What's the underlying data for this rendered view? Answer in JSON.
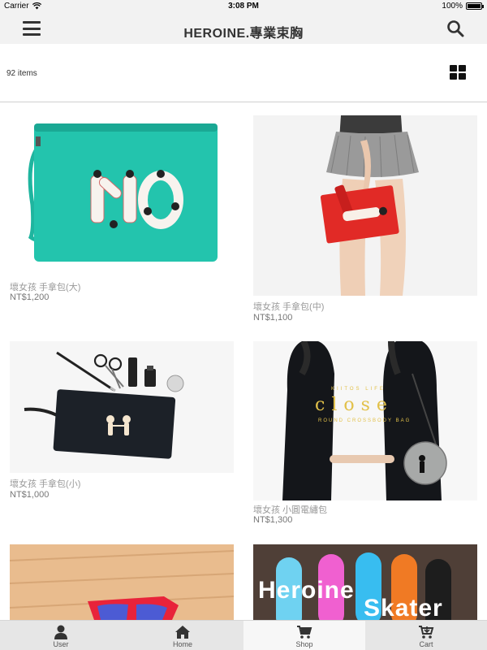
{
  "status_bar": {
    "carrier": "Carrier",
    "time": "3:08 PM",
    "battery": "100%"
  },
  "nav": {
    "title": "HEROINE.專業束胸",
    "menu_icon": "hamburger-menu-icon",
    "search_icon": "search-icon"
  },
  "toolbar": {
    "item_count": "92 items",
    "view_icon": "grid-view-icon"
  },
  "products": [
    {
      "name": "壞女孩 手拿包(大)",
      "price": "NT$1,200"
    },
    {
      "name": "壞女孩 手拿包(中)",
      "price": "NT$1,100"
    },
    {
      "name": "壞女孩 手拿包(小)",
      "price": "NT$1,000"
    },
    {
      "name": "壞女孩 小圓電繡包",
      "price": "NT$1,300"
    },
    {
      "name": "",
      "price": ""
    },
    {
      "name": "",
      "price": ""
    }
  ],
  "promo_text": {
    "bag_brand": "KIITOS LIFE",
    "bag_title": "close",
    "bag_subtitle": "ROUND CROSSBODY BAG",
    "skater_line1": "Heroine",
    "skater_line2": "Skater"
  },
  "tab_bar": {
    "tabs": [
      {
        "label": "User",
        "icon": "user-icon"
      },
      {
        "label": "Home",
        "icon": "home-icon"
      },
      {
        "label": "Shop",
        "icon": "shop-cart-icon"
      },
      {
        "label": "Cart",
        "icon": "cart-icon"
      }
    ],
    "active_tab": "Shop"
  },
  "colors": {
    "bar_background": "#f2f2f2",
    "clutch_teal": "#23c4ad",
    "clutch_red": "#e12a26",
    "pouch_black": "#1c2128"
  }
}
